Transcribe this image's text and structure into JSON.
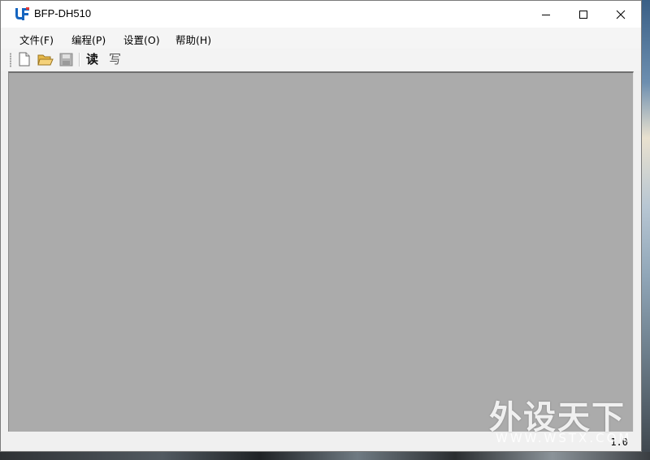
{
  "window": {
    "title": "BFP-DH510",
    "controls": {
      "minimize": "minimize",
      "maximize": "maximize",
      "close": "close"
    }
  },
  "menu": {
    "items": [
      {
        "label": "文件(F)"
      },
      {
        "label": "编程(P)"
      },
      {
        "label": "设置(O)"
      },
      {
        "label": "帮助(H)"
      }
    ]
  },
  "toolbar": {
    "buttons": [
      {
        "icon": "new-file-icon"
      },
      {
        "icon": "open-folder-icon"
      },
      {
        "icon": "save-disk-icon",
        "disabled": true
      }
    ],
    "read_label": "读",
    "write_label": "写"
  },
  "status": {
    "version": "1.0"
  },
  "watermark": {
    "main": "外设天下",
    "sub": "WWW.WSTX.COM"
  },
  "colors": {
    "client_bg": "#ababab",
    "window_bg": "#f0f0f0",
    "titlebar_bg": "#ffffff"
  }
}
